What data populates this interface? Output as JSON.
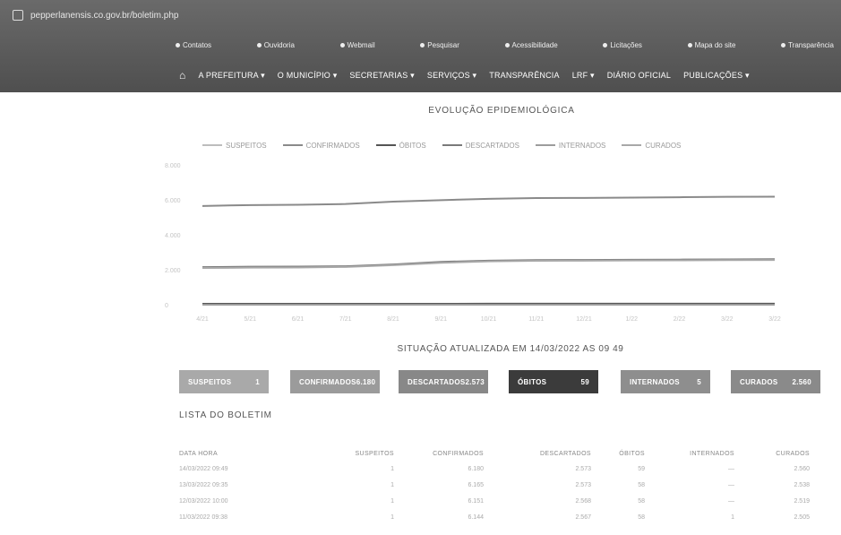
{
  "browser": {
    "url": "pepperlanensis.co.gov.br/boletim.php"
  },
  "topnav": [
    {
      "label": "Contatos",
      "icon": "phone-icon"
    },
    {
      "label": "Ouvidoria",
      "icon": "megaphone-icon"
    },
    {
      "label": "Webmail",
      "icon": "mail-icon"
    },
    {
      "label": "Pesquisar",
      "icon": "search-icon"
    },
    {
      "label": "Acessibilidade",
      "icon": "accessibility-icon"
    },
    {
      "label": "Licitações",
      "icon": "doc-icon"
    },
    {
      "label": "Mapa do site",
      "icon": "sitemap-icon"
    },
    {
      "label": "Transparência",
      "icon": "eye-icon"
    }
  ],
  "mainnav": [
    "A PREFEITURA ▾",
    "O MUNICÍPIO ▾",
    "SECRETARIAS ▾",
    "SERVIÇOS ▾",
    "TRANSPARÊNCIA",
    "LRF ▾",
    "DIÁRIO OFICIAL",
    "PUBLICAÇÕES ▾"
  ],
  "chart_data": {
    "type": "line",
    "title": "EVOLUÇÃO EPIDEMIOLÓGICA",
    "categories": [
      "4/21",
      "5/21",
      "6/21",
      "7/21",
      "8/21",
      "9/21",
      "10/21",
      "11/21",
      "12/21",
      "1/22",
      "2/22",
      "3/22",
      "3/22"
    ],
    "ylim": [
      0,
      8000
    ],
    "yticks": [
      "0",
      "2.000",
      "4.000",
      "6.000",
      "8.000"
    ],
    "series": [
      {
        "name": "SUSPEITOS",
        "color": "#bdbdbd",
        "values": [
          0,
          0,
          0,
          0,
          0,
          0,
          0,
          0,
          0,
          0,
          0,
          0,
          0
        ]
      },
      {
        "name": "CONFIRMADOS",
        "color": "#8a8a8a",
        "values": [
          5650,
          5700,
          5720,
          5760,
          5900,
          5980,
          6060,
          6100,
          6110,
          6130,
          6150,
          6170,
          6180
        ]
      },
      {
        "name": "ÓBITOS",
        "color": "#555555",
        "values": [
          50,
          50,
          52,
          52,
          53,
          54,
          55,
          56,
          56,
          58,
          58,
          59,
          59
        ]
      },
      {
        "name": "DESCARTADOS",
        "color": "#7a7a7a",
        "values": [
          2150,
          2170,
          2180,
          2200,
          2300,
          2450,
          2520,
          2550,
          2560,
          2570,
          2580,
          2590,
          2600
        ]
      },
      {
        "name": "INTERNADOS",
        "color": "#9c9c9c",
        "values": [
          0,
          0,
          0,
          0,
          0,
          0,
          0,
          0,
          0,
          0,
          0,
          0,
          0
        ]
      },
      {
        "name": "CURADOS",
        "color": "#a8a8a8",
        "values": [
          2100,
          2120,
          2130,
          2160,
          2260,
          2400,
          2480,
          2510,
          2520,
          2530,
          2540,
          2550,
          2560
        ]
      }
    ]
  },
  "status": {
    "text": "SITUAÇÃO ATUALIZADA EM 14/03/2022 AS 09 49"
  },
  "badges": [
    {
      "label": "SUSPEITOS",
      "value": "1",
      "color": "#a9a9a9"
    },
    {
      "label": "CONFIRMADOS",
      "value": "6.180",
      "color": "#9b9b9b"
    },
    {
      "label": "DESCARTADOS",
      "value": "2.573",
      "color": "#888888"
    },
    {
      "label": "ÓBITOS",
      "value": "59",
      "color": "#3b3b3b"
    },
    {
      "label": "INTERNADOS",
      "value": "5",
      "color": "#8e8e8e"
    },
    {
      "label": "CURADOS",
      "value": "2.560",
      "color": "#8a8a8a"
    }
  ],
  "list": {
    "title": "LISTA DO BOLETIM",
    "headers": [
      "DATA HORA",
      "SUSPEITOS",
      "CONFIRMADOS",
      "DESCARTADOS",
      "ÓBITOS",
      "INTERNADOS",
      "CURADOS"
    ],
    "rows": [
      [
        "14/03/2022 09:49",
        "1",
        "6.180",
        "2.573",
        "59",
        "—",
        "2.560"
      ],
      [
        "13/03/2022 09:35",
        "1",
        "6.165",
        "2.573",
        "58",
        "—",
        "2.538"
      ],
      [
        "12/03/2022 10:00",
        "1",
        "6.151",
        "2.568",
        "58",
        "—",
        "2.519"
      ],
      [
        "11/03/2022 09:38",
        "1",
        "6.144",
        "2.567",
        "58",
        "1",
        "2.505"
      ]
    ]
  }
}
